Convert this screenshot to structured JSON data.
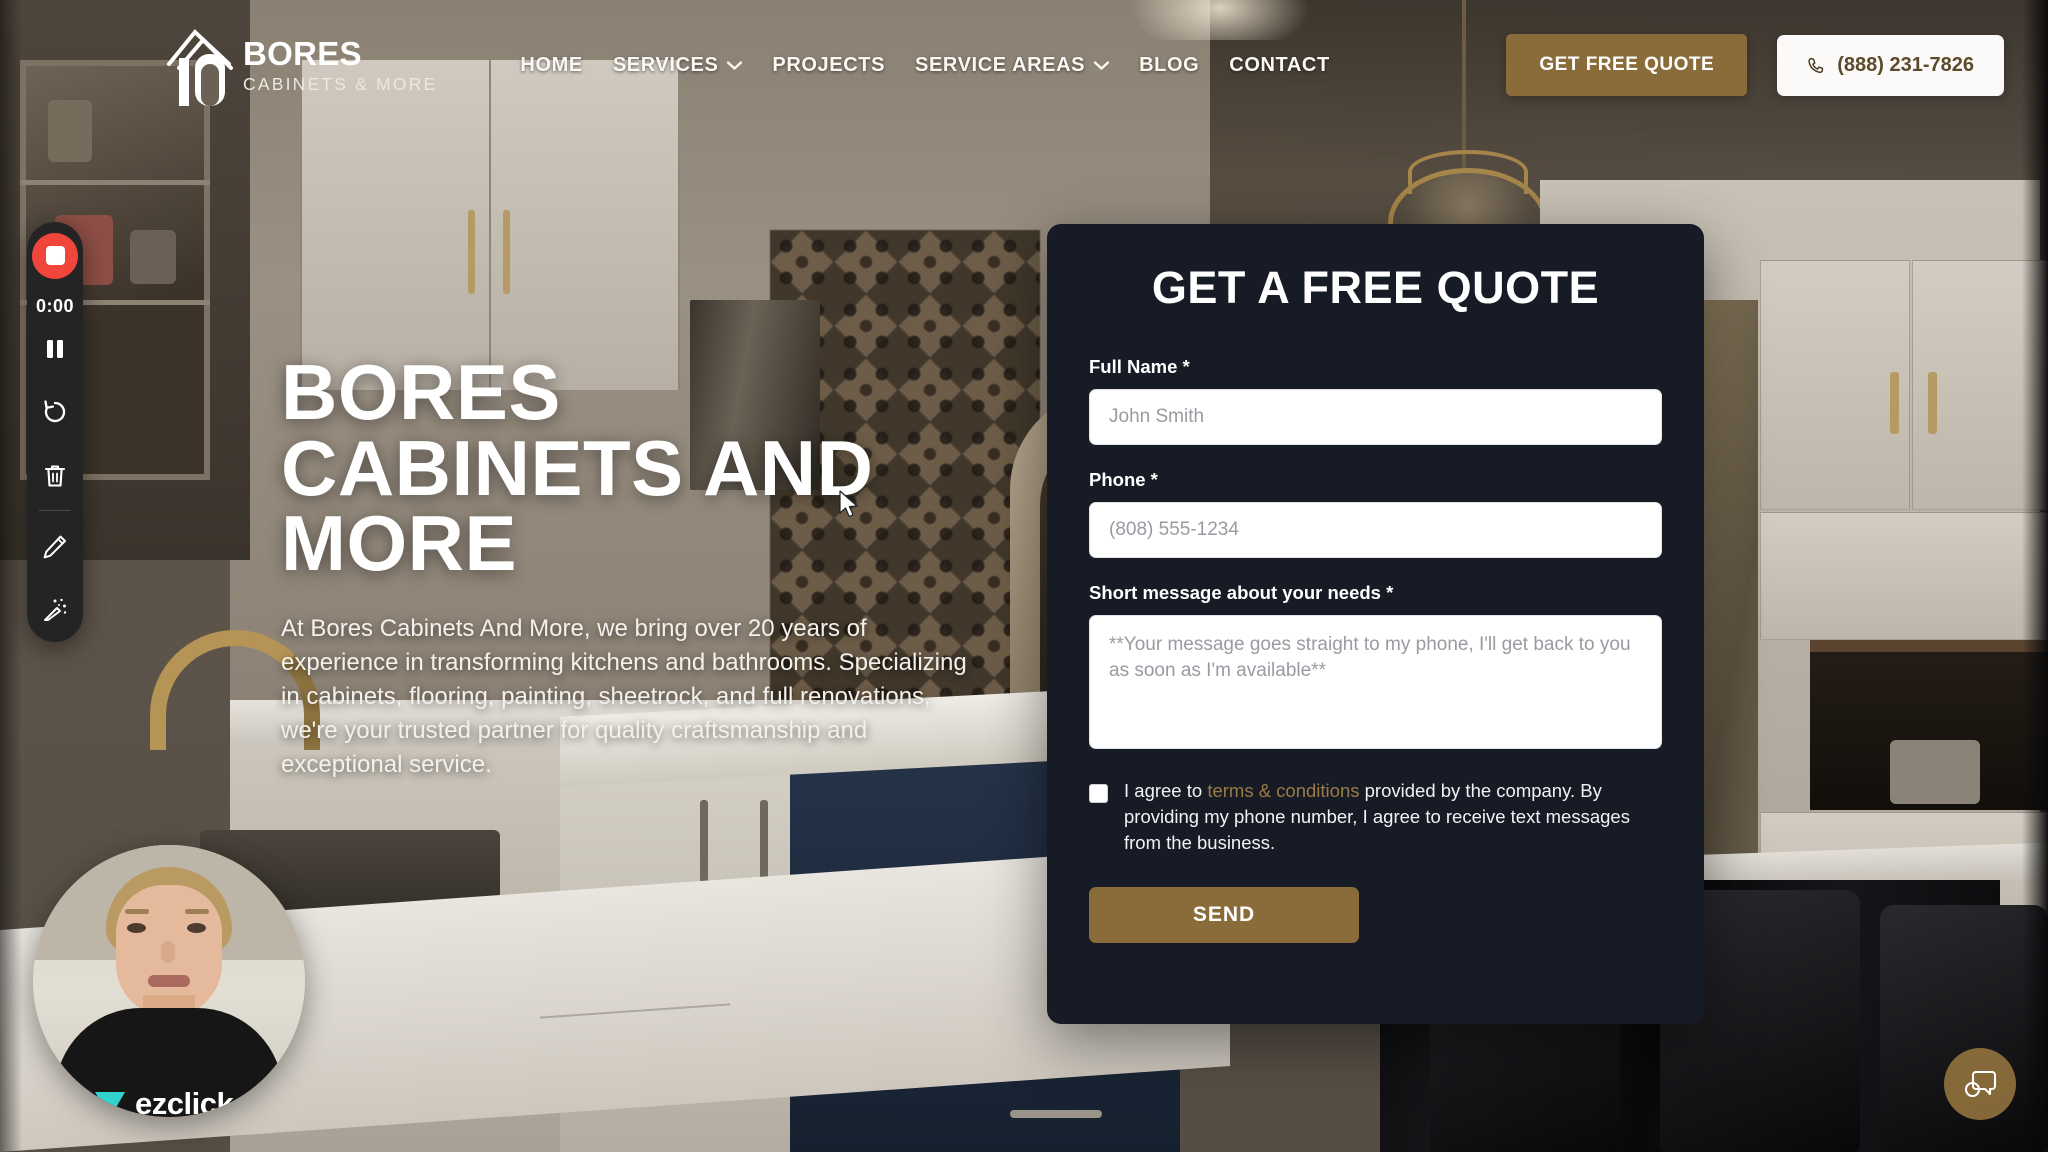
{
  "brand": {
    "name": "BORES",
    "tagline": "CABINETS & MORE",
    "logo_icon": "house-cabinet-logo"
  },
  "nav": {
    "items": [
      {
        "label": "HOME",
        "has_dropdown": false
      },
      {
        "label": "SERVICES",
        "has_dropdown": true
      },
      {
        "label": "PROJECTS",
        "has_dropdown": false
      },
      {
        "label": "SERVICE AREAS",
        "has_dropdown": true
      },
      {
        "label": "BLOG",
        "has_dropdown": false
      },
      {
        "label": "CONTACT",
        "has_dropdown": false
      }
    ]
  },
  "header_actions": {
    "quote_button": "GET FREE QUOTE",
    "phone": "(888) 231-7826",
    "phone_icon": "phone-icon"
  },
  "hero": {
    "heading": "BORES CABINETS AND MORE",
    "paragraph": "At Bores Cabinets And More, we bring over 20 years of experience in transforming kitchens and bathrooms. Specializing in cabinets, flooring, painting, sheetrock, and full renovations, we're your trusted partner for quality craftsmanship and exceptional service."
  },
  "quote_form": {
    "title": "GET A FREE QUOTE",
    "fields": {
      "full_name": {
        "label": "Full Name *",
        "placeholder": "John Smith",
        "value": ""
      },
      "phone": {
        "label": "Phone *",
        "placeholder": "(808) 555-1234",
        "value": ""
      },
      "message": {
        "label": "Short message about your needs *",
        "placeholder": "**Your message goes straight to my phone, I'll get back to you as soon as I'm available**",
        "value": ""
      }
    },
    "consent": {
      "pre": "I agree to ",
      "link": "terms & conditions",
      "post": " provided by the company. By providing my phone number, I agree to receive text messages from the business.",
      "checked": false
    },
    "submit_label": "SEND"
  },
  "recorder": {
    "timer": "0:00",
    "controls": [
      {
        "name": "stop-recording-button",
        "icon": "stop-square-icon"
      },
      {
        "name": "pause-button",
        "icon": "pause-icon"
      },
      {
        "name": "restart-button",
        "icon": "restart-arrow-icon"
      },
      {
        "name": "delete-button",
        "icon": "trash-icon"
      },
      {
        "name": "draw-button",
        "icon": "pencil-icon"
      },
      {
        "name": "effects-button",
        "icon": "magic-wand-icon"
      }
    ]
  },
  "webcam": {
    "shirt_brand": "ezclick",
    "shirt_logo_icon": "triangle-play-icon"
  },
  "chat_widget": {
    "icon": "chat-bubbles-icon"
  },
  "colors": {
    "accent_gold": "#8a6c3a",
    "panel_dark": "#171b26",
    "record_red": "#f0453a",
    "link_gold": "#9a7b45"
  }
}
